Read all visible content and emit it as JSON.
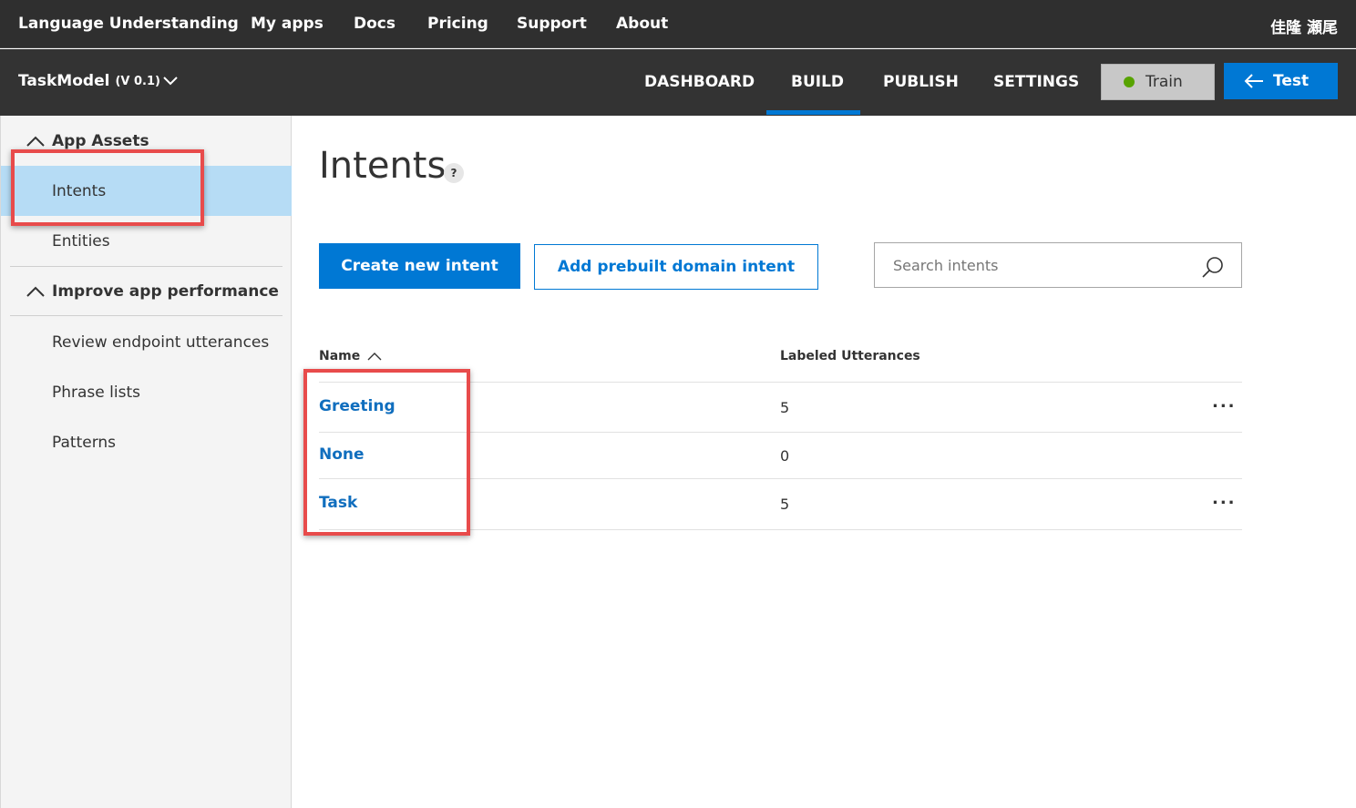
{
  "topbar": {
    "brand": "Language Understanding",
    "nav": [
      "My apps",
      "Docs",
      "Pricing",
      "Support",
      "About"
    ],
    "user": "佳隆 瀬尾"
  },
  "appbar": {
    "app_name": "TaskModel",
    "version": "(V 0.1)",
    "tabs": [
      "DASHBOARD",
      "BUILD",
      "PUBLISH",
      "SETTINGS"
    ],
    "active_tab": "BUILD",
    "train_label": "Train",
    "test_label": "Test"
  },
  "sidebar": {
    "groups": [
      {
        "label": "App Assets",
        "items": [
          "Intents",
          "Entities"
        ]
      },
      {
        "label": "Improve app performance",
        "items": [
          "Review endpoint utterances",
          "Phrase lists",
          "Patterns"
        ]
      }
    ],
    "active_item": "Intents"
  },
  "main": {
    "title": "Intents",
    "help": "?",
    "create_button": "Create new intent",
    "prebuilt_button": "Add prebuilt domain intent",
    "search_placeholder": "Search intents",
    "columns": [
      "Name",
      "Labeled Utterances"
    ],
    "rows": [
      {
        "name": "Greeting",
        "count": "5",
        "more": "..."
      },
      {
        "name": "None",
        "count": "0",
        "more": ""
      },
      {
        "name": "Task",
        "count": "5",
        "more": "..."
      }
    ]
  },
  "colors": {
    "accent": "#0078d4",
    "topbar": "#2f2f2f",
    "active_nav": "#b6dcf5",
    "highlight": "#e84b4b"
  }
}
